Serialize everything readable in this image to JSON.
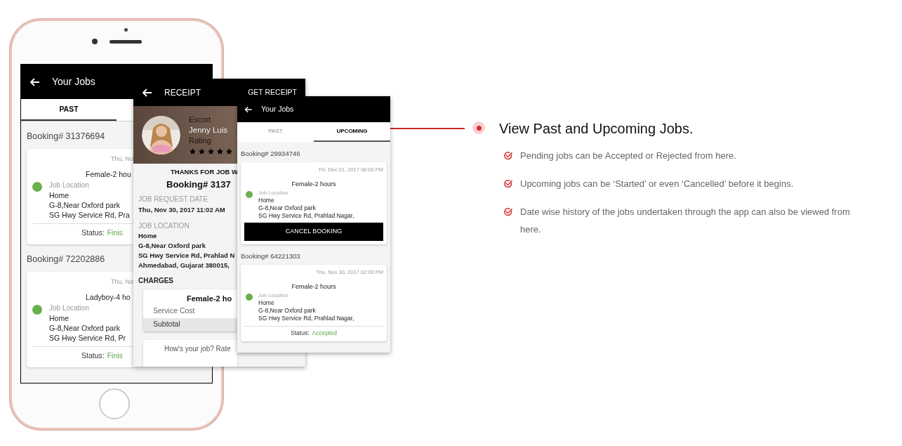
{
  "past_jobs_screen": {
    "title": "Your Jobs",
    "tabs": [
      {
        "label": "PAST",
        "selected": true
      }
    ],
    "bookings": [
      {
        "number": "Booking# 31376694",
        "date": "Thu, No",
        "service": "Female-2 hou",
        "location_label": "Job Location",
        "address": [
          "Home",
          "G-8,Near Oxford park",
          "SG Hwy Service Rd, Pra"
        ],
        "status_label": "Status:",
        "status": "Finis"
      },
      {
        "number": "Booking# 72202886",
        "date": "Thu, No",
        "service": "Ladyboy-4 ho",
        "location_label": "Job Location",
        "address": [
          "Home",
          "G-8,Near Oxford park",
          "SG Hwy Service Rd, Pr"
        ],
        "status_label": "Status:",
        "status": "Finis"
      }
    ]
  },
  "receipt_screen": {
    "title": "RECEIPT",
    "action": "GET RECEIPT",
    "provider": {
      "category": "Escort",
      "name": "Jenny Luis",
      "rating_label": "Rating",
      "stars": 5
    },
    "thanks": "THANKS FOR JOB W",
    "booking": "Booking# 3137",
    "request_date_label": "JOB REQUEST DATE",
    "request_date": "Thu, Nov 30, 2017 11:02 AM",
    "location_label": "JOB LOCATION",
    "location": [
      "Home",
      "G-8,Near Oxford park",
      "SG Hwy Service Rd, Prahlad N",
      "Ahmedabad, Gujarat 380015,"
    ],
    "charges_label": "CHARGES",
    "charge_title": "Female-2 ho",
    "charge_rows": [
      {
        "kind": "item",
        "label": "Service Cost"
      },
      {
        "kind": "subtotal",
        "label": "Subtotal"
      }
    ],
    "rate_prompt": "How's your job? Rate"
  },
  "upcoming_screen": {
    "title": "Your Jobs",
    "tabs": [
      {
        "label": "PAST",
        "selected": false
      },
      {
        "label": "UPCOMING",
        "selected": true
      }
    ],
    "bookings": [
      {
        "number": "Booking# 29934746",
        "date": "Fri, Dec 01, 2017 08:00 PM",
        "service": "Female-2 hours",
        "location_label": "Job Location",
        "address": [
          "Home",
          "G-8,Near Oxford park",
          "SG Hwy Service Rd, Prahlad Nagar,"
        ],
        "action": "CANCEL BOOKING"
      },
      {
        "number": "Booking# 64221303",
        "date": "Thu, Nov 30, 2017 02:00 PM",
        "service": "Female-2 hours",
        "location_label": "Job Location",
        "address": [
          "Home",
          "G-8,Near Oxford park",
          "SG Hwy Service Rd, Prahlad Nagar,"
        ],
        "status_label": "Status:",
        "status": "Accepted"
      }
    ]
  },
  "feature": {
    "title": "View Past and Upcoming Jobs.",
    "points": [
      "Pending jobs can be Accepted or Rejected from here.",
      "Upcoming jobs can be ‘Started’ or even ‘Cancelled’ before it begins.",
      "Date wise history of the jobs undertaken through the app can also be viewed from here."
    ]
  }
}
